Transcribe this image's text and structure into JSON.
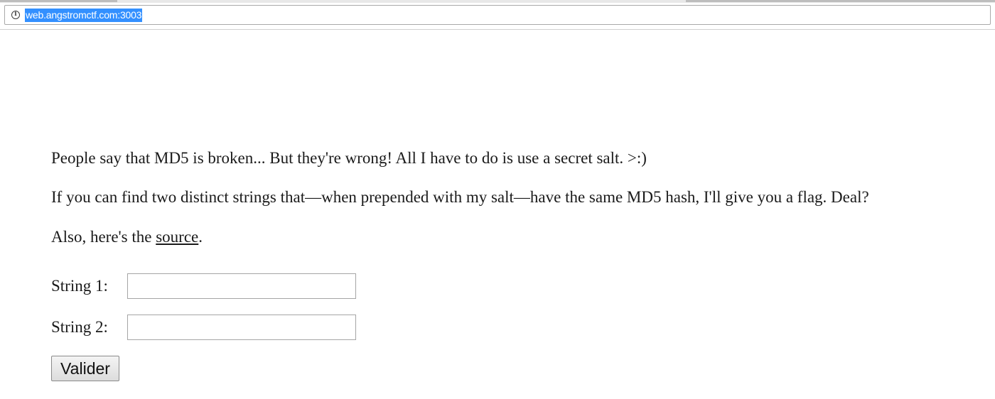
{
  "browser": {
    "url": "web.angstromctf.com:3003",
    "info_icon": "info-icon",
    "info_glyph": "i"
  },
  "page": {
    "paragraph_1": "People say that MD5 is broken... But they're wrong! All I have to do is use a secret salt. >:)",
    "paragraph_2": "If you can find two distinct strings that—when prepended with my salt—have the same MD5 hash, I'll give you a flag. Deal?",
    "paragraph_3_prefix": "Also, here's the ",
    "source_link": "source",
    "paragraph_3_suffix": "."
  },
  "form": {
    "string1_label": "String 1:",
    "string1_value": "",
    "string2_label": "String 2:",
    "string2_value": "",
    "submit_label": "Valider"
  },
  "colors": {
    "url_highlight": "#3390ff",
    "text": "#1a1a1a"
  }
}
